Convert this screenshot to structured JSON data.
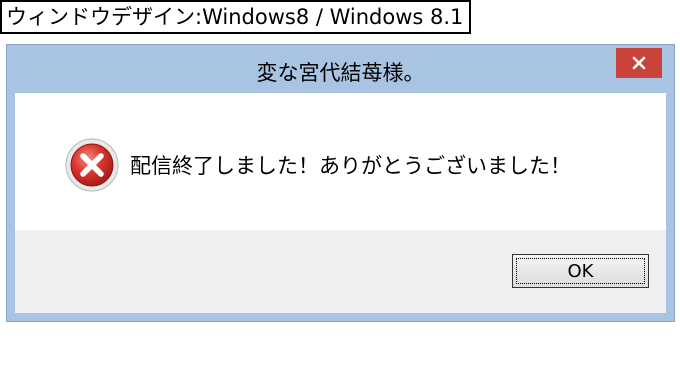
{
  "caption": "ウィンドウデザイン:Windows8 / Windows 8.1",
  "window": {
    "title": "変な宮代結苺様。",
    "close_icon": "close-icon",
    "message": "配信終了しました！ありがとうございました！",
    "message_icon": "error-icon",
    "ok_label": "OK"
  },
  "colors": {
    "frame": "#a9c4e2",
    "close_button": "#c9433a",
    "button_area": "#efefef"
  }
}
